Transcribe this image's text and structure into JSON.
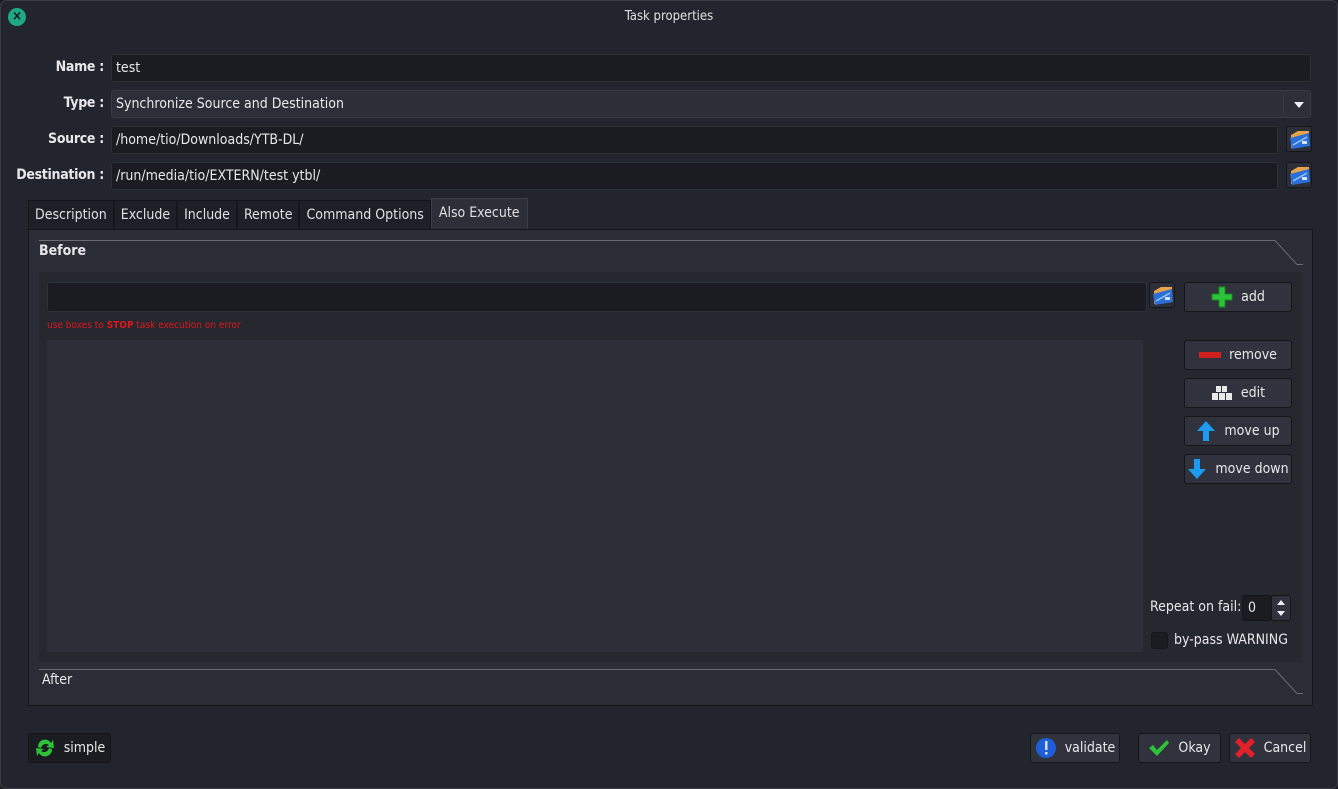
{
  "window": {
    "title": "Task properties"
  },
  "form": {
    "name_label": "Name :",
    "name_value": "test",
    "type_label": "Type :",
    "type_value": "Synchronize Source and Destination",
    "source_label": "Source :",
    "source_value": "/home/tio/Downloads/YTB-DL/",
    "destination_label": "Destination :",
    "destination_value": "/run/media/tio/EXTERN/test ytbl/"
  },
  "tabs": [
    {
      "label": "Description"
    },
    {
      "label": "Exclude"
    },
    {
      "label": "Include"
    },
    {
      "label": "Remote"
    },
    {
      "label": "Command Options"
    },
    {
      "label": "Also Execute",
      "active": true
    }
  ],
  "also_execute": {
    "before_label": "Before",
    "after_label": "After",
    "command_value": "",
    "warning_prefix": "use boxes to ",
    "warning_strong": "STOP",
    "warning_suffix": " task execution on error",
    "buttons": {
      "add": "add",
      "remove": "remove",
      "edit": "edit",
      "move_up": "move up",
      "move_down": "move down"
    },
    "repeat_label": "Repeat on fail:",
    "repeat_value": "0",
    "bypass_label": "by-pass WARNING",
    "bypass_checked": false
  },
  "footer": {
    "simple": "simple",
    "validate": "validate",
    "okay": "Okay",
    "cancel": "Cancel"
  },
  "icons": {
    "close": "close-icon",
    "folder": "folder-icon",
    "add": "plus-icon",
    "remove": "minus-icon",
    "edit": "blocks-icon",
    "move_up": "arrow-up-icon",
    "move_down": "arrow-down-icon",
    "simple": "refresh-icon",
    "validate": "exclamation-icon",
    "okay": "check-icon",
    "cancel": "x-icon"
  }
}
